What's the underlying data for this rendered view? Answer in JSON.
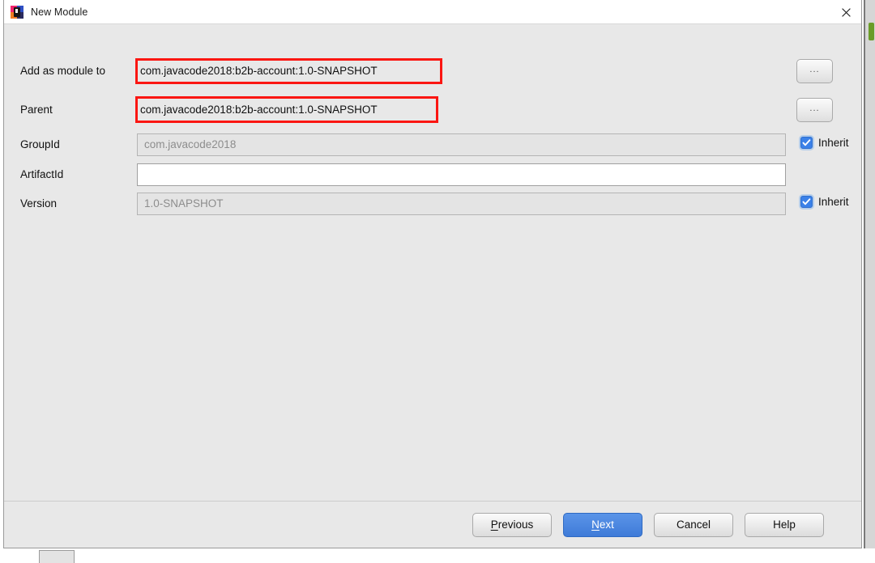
{
  "window": {
    "title": "New Module",
    "app_icon": "intellij-idea-icon",
    "close_icon": "close-icon"
  },
  "form": {
    "rows": [
      {
        "label": "Add as module to",
        "value": "com.javacode2018:b2b-account:1.0-SNAPSHOT",
        "type": "combo-value",
        "annotated": true,
        "browse": true,
        "browse_label": "...",
        "inherit": false
      },
      {
        "label": "Parent",
        "value": "com.javacode2018:b2b-account:1.0-SNAPSHOT",
        "type": "combo-value",
        "annotated": true,
        "browse": true,
        "browse_label": "...",
        "inherit": false
      },
      {
        "label": "GroupId",
        "value": "com.javacode2018",
        "type": "text-disabled",
        "annotated": false,
        "browse": false,
        "inherit": true,
        "inherit_label": "Inherit",
        "inherit_checked": true
      },
      {
        "label": "ArtifactId",
        "value": "",
        "type": "text-editable",
        "annotated": false,
        "browse": false,
        "inherit": false
      },
      {
        "label": "Version",
        "value": "1.0-SNAPSHOT",
        "type": "text-disabled",
        "annotated": false,
        "browse": false,
        "inherit": true,
        "inherit_label": "Inherit",
        "inherit_checked": true
      }
    ]
  },
  "buttons": {
    "previous": {
      "label": "Previous",
      "mnemonic": "P",
      "default": false
    },
    "next": {
      "label": "Next",
      "mnemonic": "N",
      "default": true
    },
    "cancel": {
      "label": "Cancel",
      "default": false
    },
    "help": {
      "label": "Help",
      "default": false
    }
  },
  "colors": {
    "annotation_red": "#fb1612",
    "default_button_blue": "#3f7bd8",
    "checkbox_blue": "#3b81e8",
    "dialog_background": "#e8e8e8"
  }
}
